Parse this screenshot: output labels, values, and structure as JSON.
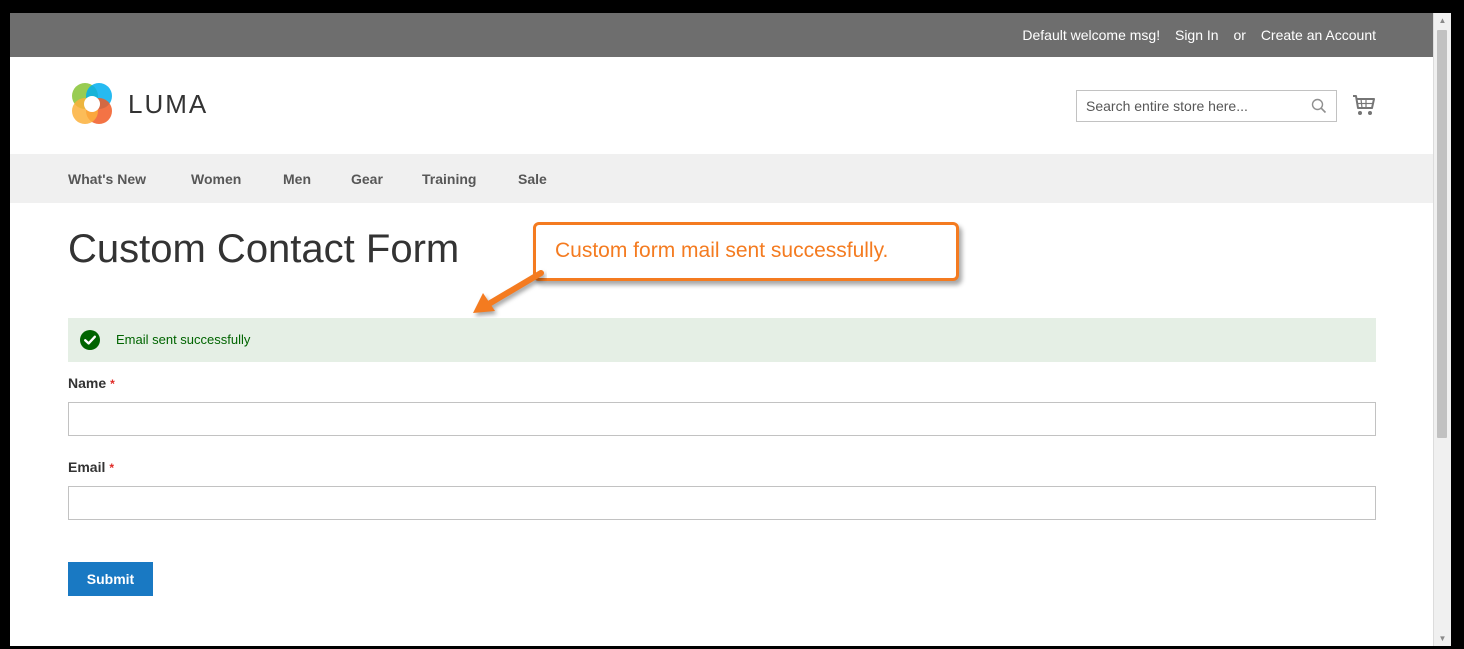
{
  "header": {
    "welcome": "Default welcome msg!",
    "sign_in": "Sign In",
    "or": "or",
    "create_account": "Create an Account"
  },
  "logo": {
    "text": "LUMA"
  },
  "search": {
    "placeholder": "Search entire store here...",
    "value": ""
  },
  "nav": {
    "items": [
      {
        "label": "What's New"
      },
      {
        "label": "Women"
      },
      {
        "label": "Men"
      },
      {
        "label": "Gear"
      },
      {
        "label": "Training"
      },
      {
        "label": "Sale"
      }
    ]
  },
  "page": {
    "title": "Custom Contact Form"
  },
  "callout": {
    "text": "Custom form mail sent successfully."
  },
  "message": {
    "text": "Email sent successfully"
  },
  "form": {
    "name_label": "Name",
    "email_label": "Email",
    "required_mark": "*",
    "name_value": "",
    "email_value": "",
    "submit_label": "Submit"
  },
  "colors": {
    "header_bg": "#6e6e6e",
    "nav_bg": "#f0f0f0",
    "primary_button": "#1979c3",
    "success_bg": "#e5efe5",
    "success_text": "#006400",
    "callout_accent": "#f47b20",
    "required": "#e02b27"
  },
  "icons": {
    "logo": "luma-logo-icon",
    "search": "search-icon",
    "cart": "shopping-cart-icon",
    "success": "check-circle-icon"
  }
}
